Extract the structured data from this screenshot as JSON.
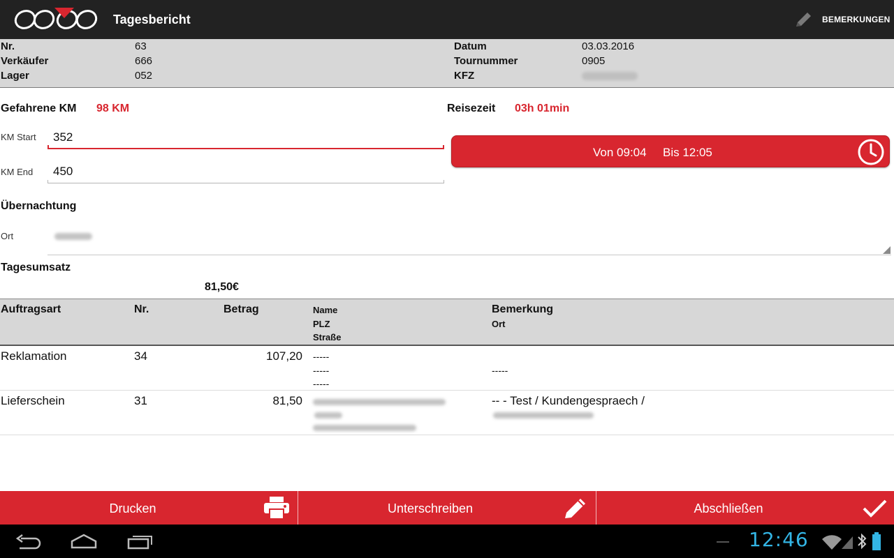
{
  "app": {
    "title": "Tagesbericht",
    "remarks_action": "BEMERKUNGEN"
  },
  "info": {
    "nr_label": "Nr.",
    "nr_value": "63",
    "seller_label": "Verkäufer",
    "seller_value": "666",
    "warehouse_label": "Lager",
    "warehouse_value": "052",
    "date_label": "Datum",
    "date_value": "03.03.2016",
    "tour_label": "Tournummer",
    "tour_value": "0905",
    "vehicle_label": "KFZ"
  },
  "km": {
    "title": "Gefahrene KM",
    "value": "98 KM",
    "start_label": "KM Start",
    "start_value": "352",
    "end_label": "KM End",
    "end_value": "450"
  },
  "travel": {
    "title": "Reisezeit",
    "value": "03h 01min",
    "from": "Von 09:04",
    "to": "Bis 12:05"
  },
  "overnight": {
    "title": "Übernachtung",
    "place_label": "Ort"
  },
  "revenue": {
    "title": "Tagesumsatz",
    "value": "81,50€"
  },
  "table": {
    "headers": {
      "type": "Auftragsart",
      "nr": "Nr.",
      "amount": "Betrag",
      "name": "Name",
      "plz": "PLZ",
      "street": "Straße",
      "remark": "Bemerkung",
      "place": "Ort"
    },
    "rows": [
      {
        "type": "Reklamation",
        "nr": "34",
        "amount": "107,20",
        "name": "-----",
        "plz": "-----",
        "street": "-----",
        "remark": "",
        "place": "-----"
      },
      {
        "type": "Lieferschein",
        "nr": "31",
        "amount": "81,50",
        "remark": "-- - Test / Kundengespraech /"
      }
    ]
  },
  "buttons": {
    "print": "Drucken",
    "sign": "Unterschreiben",
    "close": "Abschließen"
  },
  "system": {
    "time": "12:46"
  },
  "colors": {
    "accent": "#d8262f",
    "actionbar": "#222222",
    "header_bg": "#d7d7d7",
    "status_blue": "#33b5e5"
  }
}
